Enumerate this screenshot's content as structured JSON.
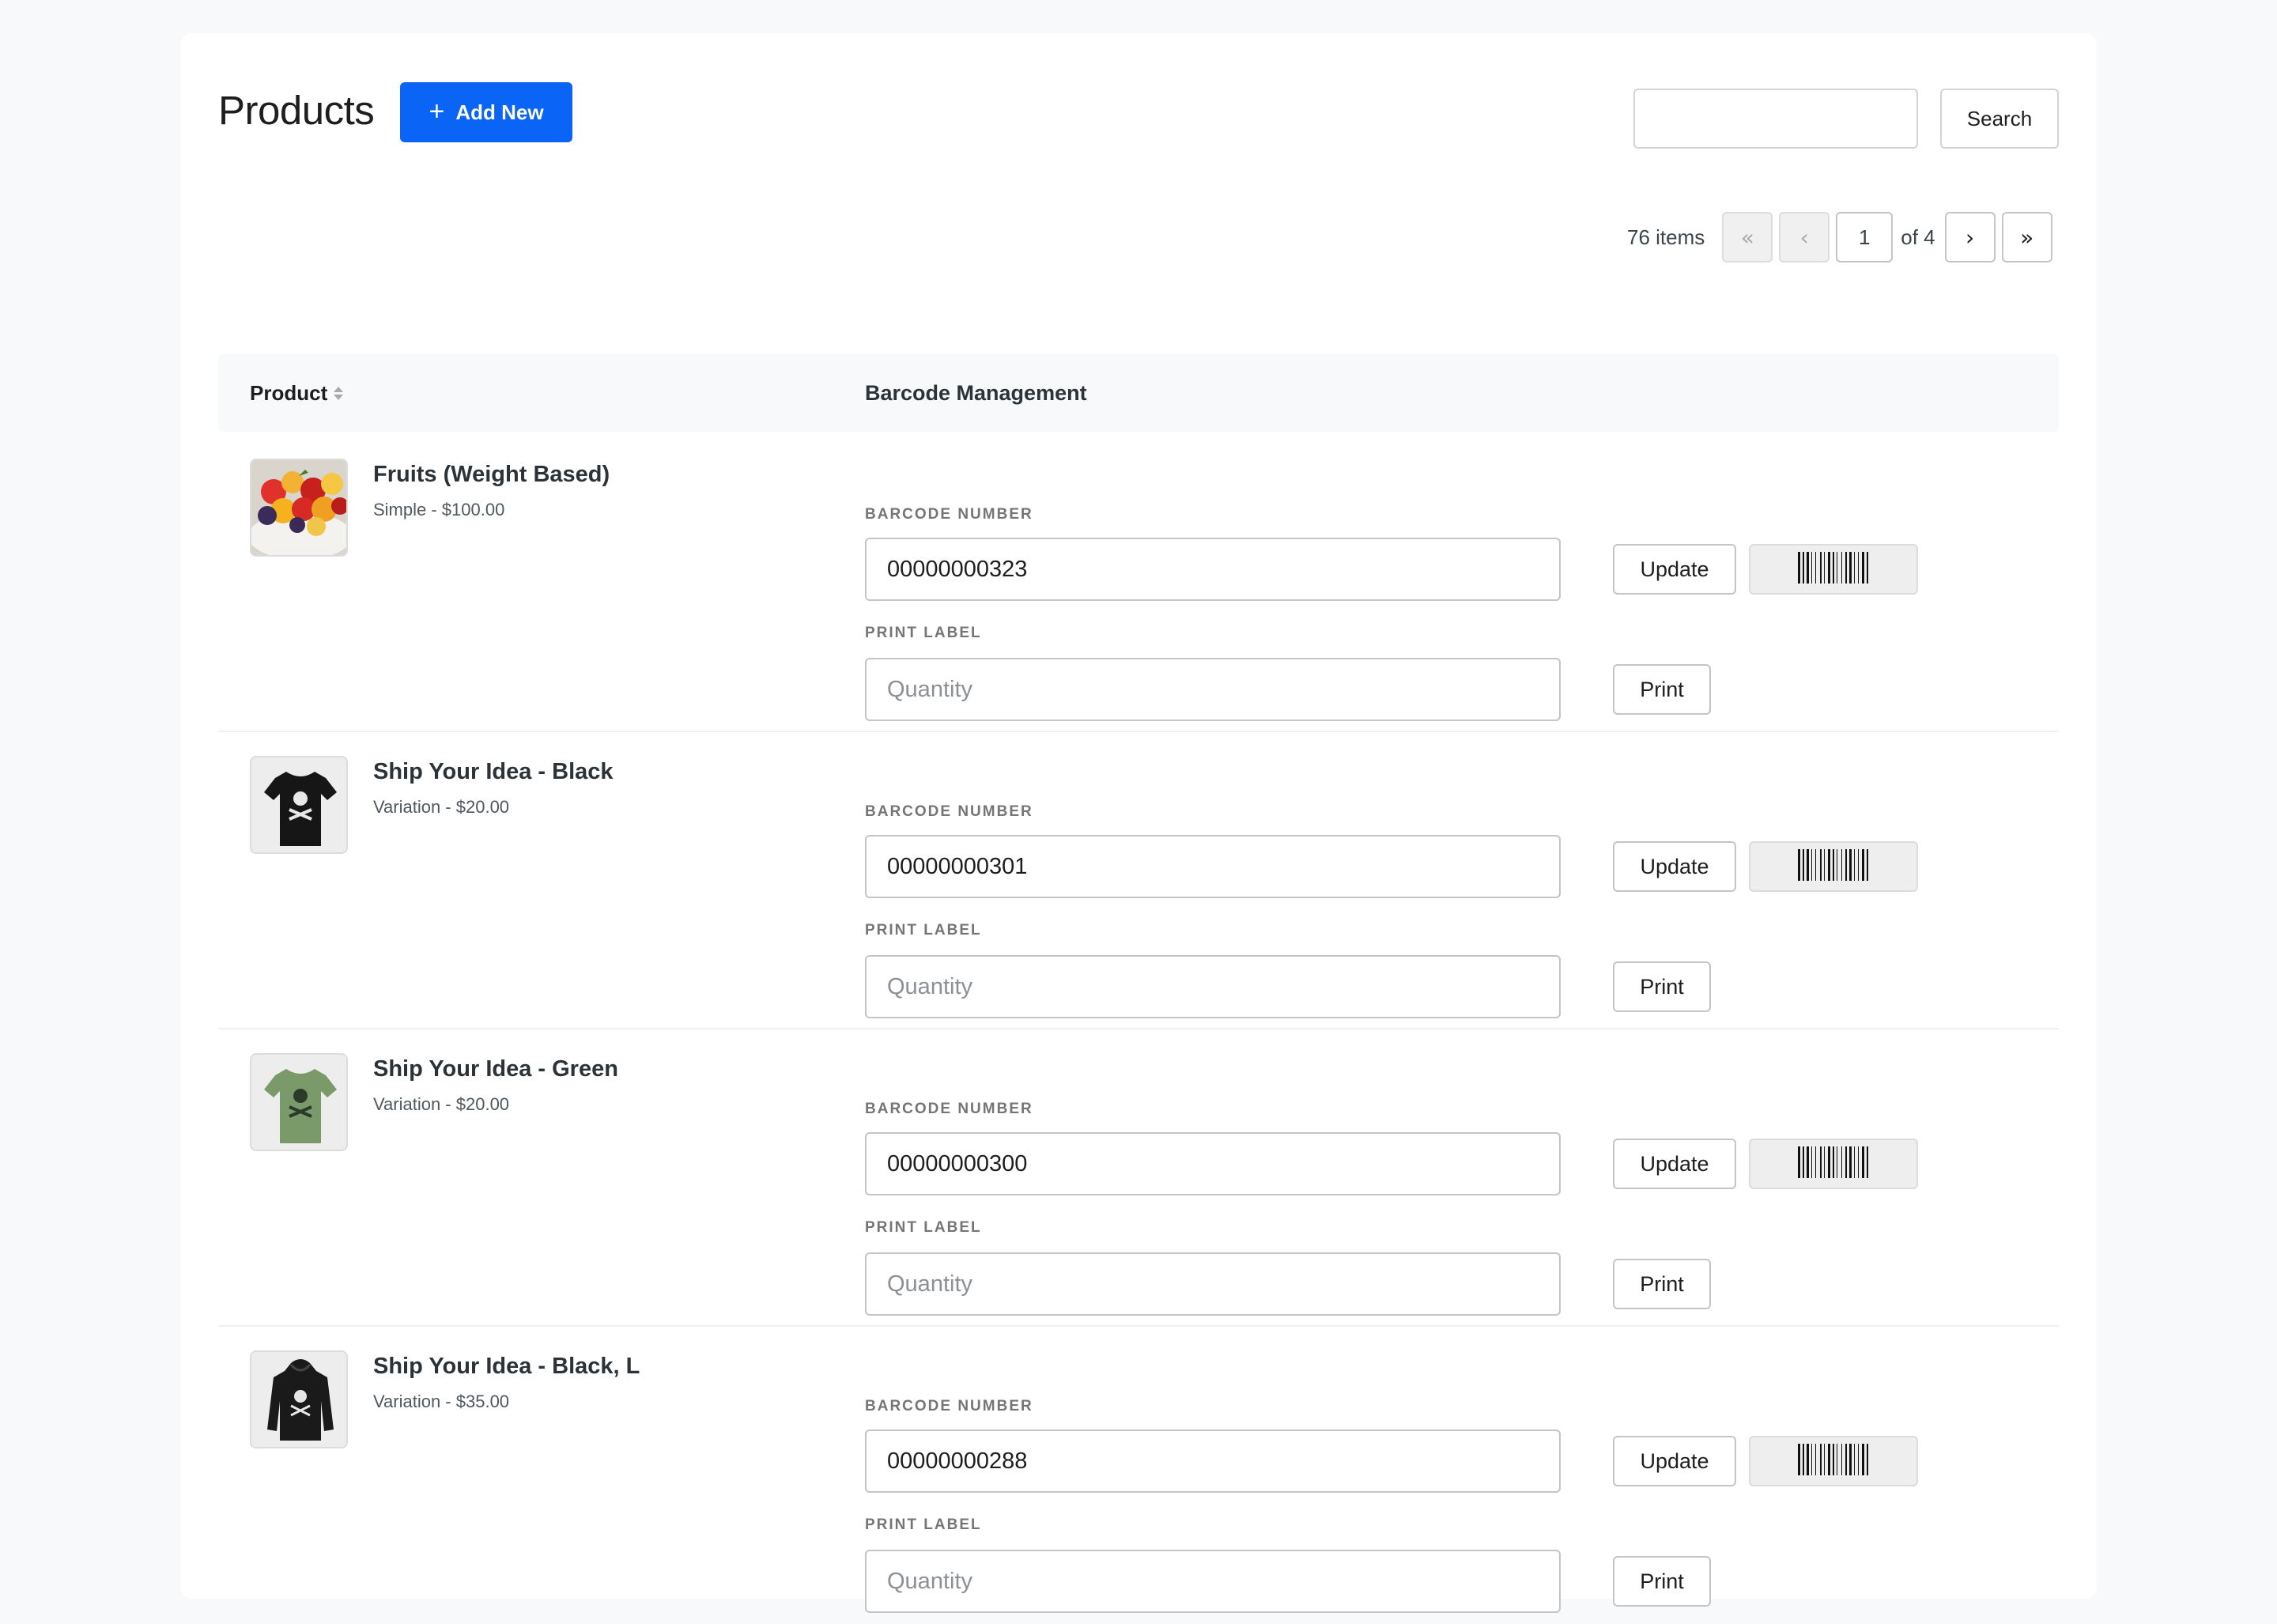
{
  "header": {
    "title": "Products",
    "add_new_label": "Add New",
    "add_new_icon": "plus-icon",
    "search_value": "",
    "search_button_label": "Search"
  },
  "pagination": {
    "items_count": "76 items",
    "first": "«",
    "prev": "‹",
    "current_page": "1",
    "of_total": "of 4",
    "next": "›",
    "last": "»"
  },
  "table": {
    "columns": [
      "Product",
      "Barcode Management"
    ],
    "sort_icon": "sort-icon"
  },
  "labels": {
    "barcode_number": "Barcode Number",
    "print_label": "Print Label",
    "quantity_placeholder": "Quantity",
    "update_button": "Update",
    "print_button": "Print"
  },
  "rows": [
    {
      "name": "Fruits (Weight Based)",
      "meta": "Simple - $100.00",
      "barcode": "00000000323",
      "thumbnail": "fruit-bowl"
    },
    {
      "name": "Ship Your Idea - Black",
      "meta": "Variation - $20.00",
      "barcode": "00000000301",
      "thumbnail": "black-tshirt"
    },
    {
      "name": "Ship Your Idea - Green",
      "meta": "Variation - $20.00",
      "barcode": "00000000300",
      "thumbnail": "green-tshirt"
    },
    {
      "name": "Ship Your Idea - Black, L",
      "meta": "Variation - $35.00",
      "barcode": "00000000288",
      "thumbnail": "black-hoodie"
    }
  ],
  "colors": {
    "primary": "#0a64f5",
    "background": "#f8f9fb",
    "card": "#ffffff"
  }
}
